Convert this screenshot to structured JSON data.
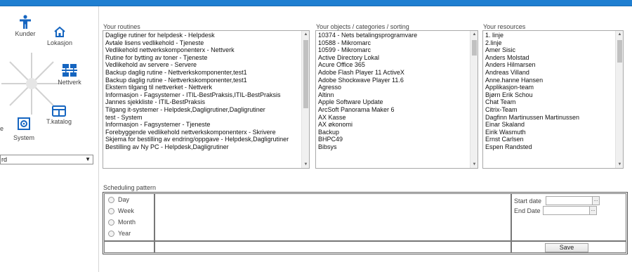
{
  "nav": {
    "items": [
      {
        "label": "Kunder",
        "icon": "person-icon"
      },
      {
        "label": "Lokasjon",
        "icon": "home-icon"
      },
      {
        "label": "Nettverk",
        "icon": "network-icon"
      },
      {
        "label": "T.katalog",
        "icon": "catalog-icon"
      },
      {
        "label": "System",
        "icon": "disk-icon"
      },
      {
        "label": "e",
        "icon": ""
      }
    ],
    "dropdown_value": "rd"
  },
  "routines": {
    "label": "Your routines",
    "items": [
      "Daglige rutiner for helpdesk - Helpdesk",
      "Avtale lisens vedlikehold - Tjeneste",
      "Vedlikehold nettverkskomponenterx - Nettverk",
      "Rutine for bytting av toner - Tjeneste",
      "Vedlikehold av servere - Servere",
      "Backup daglig rutine - Nettverkskomponenter,test1",
      "Backup daglig rutine - Nettverkskomponenter,test1",
      "Ekstern tilgang til nettverket - Nettverk",
      "Informasjon - Fagsystemer - ITIL-BestPraksis,ITIL-BestPraksis",
      "Jannes sjekkliste - ITIL-BestPraksis",
      "Tilgang it-systemer - Helpdesk,Dagligrutiner,Dagligrutiner",
      "test - System",
      "Informasjon - Fagsystemer - Tjeneste",
      "Forebyggende vedlikehold nettverkskomponenterx - Skrivere",
      "Skjema for bestilling av endring/oppgave - Helpdesk,Dagligrutiner",
      "Bestilling av Ny PC - Helpdesk,Dagligrutiner"
    ]
  },
  "objects": {
    "label": "Your objects / categories / sorting",
    "items": [
      "10374 - Nets betalingsprogramvare",
      "10588 - Mikromarc",
      "10599 - Mikromarc",
      "Active Directory Lokal",
      "Acure Office 365",
      "Adobe Flash Player 11 ActiveX",
      "Adobe Shockwave Player 11.6",
      "Agresso",
      "Altinn",
      "Apple Software Update",
      "ArcSoft Panorama Maker 6",
      "AX Kasse",
      "AX økonomi",
      "Backup",
      "BHPC49",
      "Bibsys"
    ]
  },
  "resources": {
    "label": "Your resources",
    "items": [
      "1. linje",
      "2.linje",
      "Amer Sisic",
      "Anders Molstad",
      "Anders Hilmarsen",
      "Andreas Villand",
      "Anne.hanne Hansen",
      "Applikasjon-team",
      "Bjørn Erik Schou",
      "Chat Team",
      "Citrix-Team",
      "Dagfinn Martinussen Martinussen",
      "Einar Skaland",
      "Eirik Wasmuth",
      "Ernst Carlsen",
      "Espen Randsted"
    ]
  },
  "scheduling": {
    "label": "Scheduling pattern",
    "options": [
      "Day",
      "Week",
      "Month",
      "Year"
    ],
    "start_date_label": "Start date",
    "end_date_label": "End Date",
    "date_button": "...",
    "save_label": "Save"
  },
  "colors": {
    "topbar": "#1f7fd1",
    "icon": "#1565c0"
  }
}
